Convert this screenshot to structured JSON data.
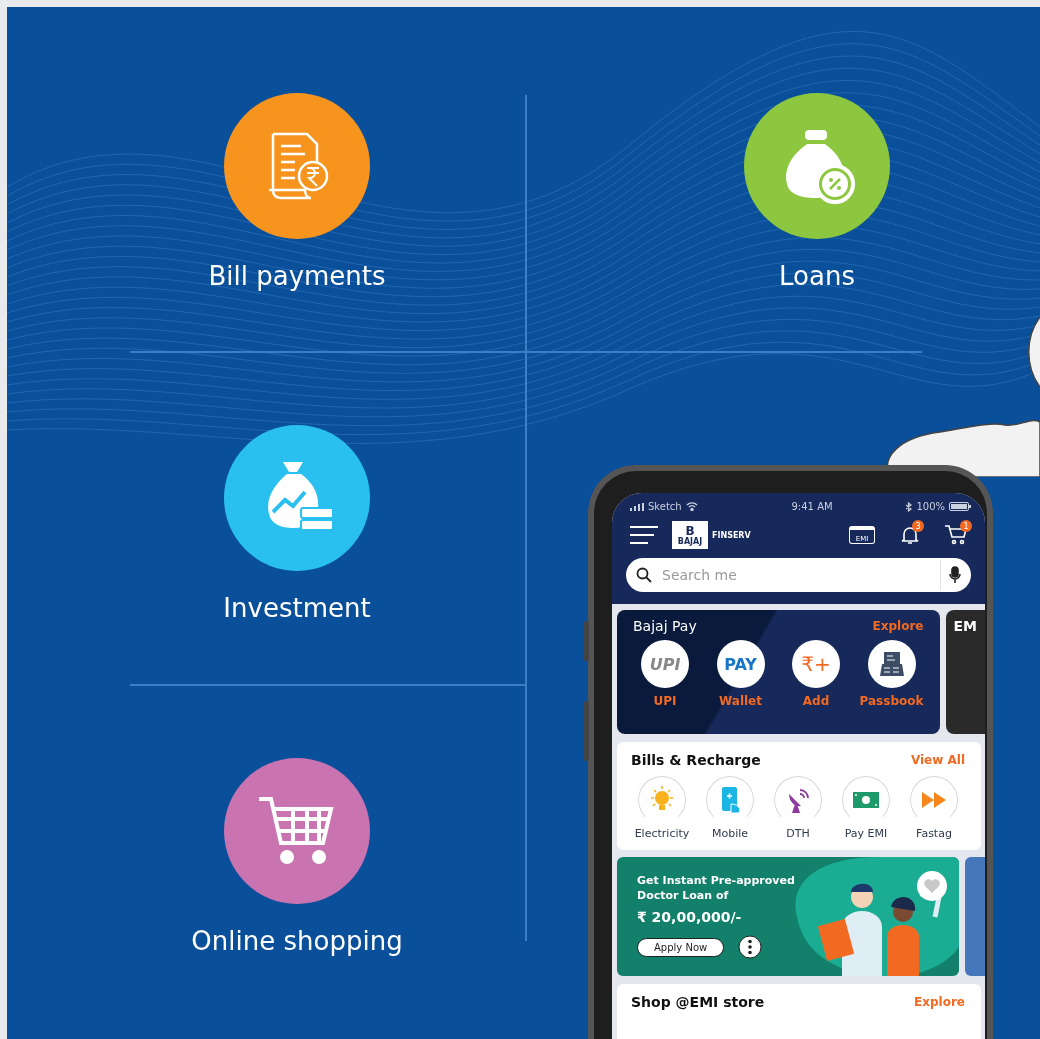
{
  "features": [
    {
      "label": "Bill payments",
      "kind": "bill",
      "color": "#f7941d"
    },
    {
      "label": "Loans",
      "kind": "loan",
      "color": "#8dc63f"
    },
    {
      "label": "Investment",
      "kind": "investment",
      "color": "#29c0ef"
    },
    {
      "label": "Online shopping",
      "kind": "shopping",
      "color": "#c974b0"
    }
  ],
  "phone": {
    "status_bar": {
      "carrier": "Sketch",
      "time": "9:41 AM",
      "battery": "100%"
    },
    "header": {
      "logo_mark": "B",
      "logo_sub": "BAJAJ",
      "brand": "FINSERV",
      "emi": "EMI",
      "notifications": "3",
      "cart": "1"
    },
    "search": {
      "placeholder": "Search me"
    },
    "bajaj_pay": {
      "title": "Bajaj Pay",
      "link": "Explore",
      "next_card_title": "EM",
      "items": [
        {
          "label": "UPI",
          "kind": "upi",
          "icon_text": "UPI"
        },
        {
          "label": "Wallet",
          "kind": "pay",
          "icon_text": "PAY"
        },
        {
          "label": "Add",
          "kind": "add",
          "icon_text": "₹+"
        },
        {
          "label": "Passbook",
          "kind": "passbook"
        }
      ]
    },
    "bills": {
      "title": "Bills & Recharge",
      "link": "View All",
      "items": [
        {
          "label": "Electricity",
          "kind": "bulb"
        },
        {
          "label": "Mobile",
          "kind": "mobile"
        },
        {
          "label": "DTH",
          "kind": "dish"
        },
        {
          "label": "Pay EMI",
          "kind": "money"
        },
        {
          "label": "Fastag",
          "kind": "fast"
        }
      ]
    },
    "promo": {
      "title": "Get Instant Pre-approved Doctor Loan of",
      "amount": "₹ 20,00,000/-",
      "button": "Apply Now"
    },
    "shop": {
      "title": "Shop @EMI store",
      "link": "Explore"
    }
  }
}
